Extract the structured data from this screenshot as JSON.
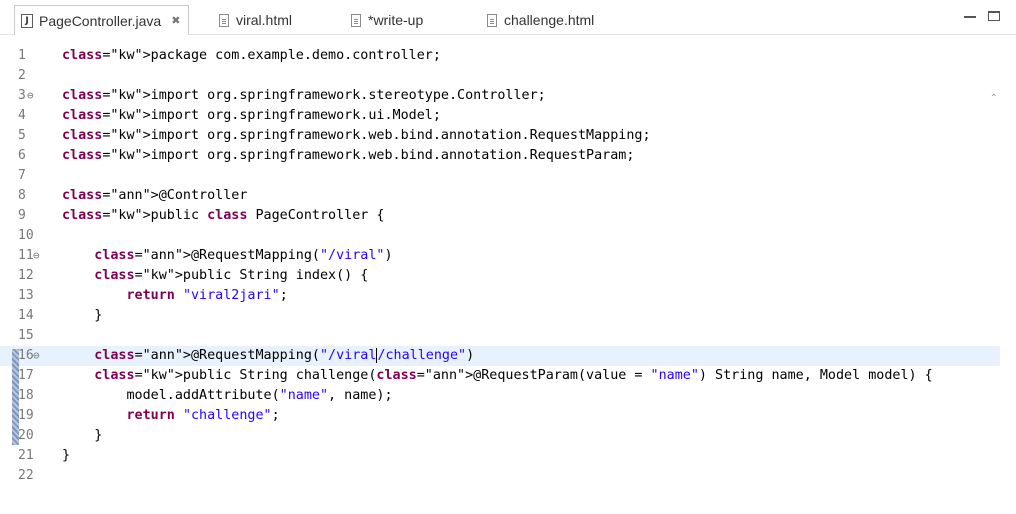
{
  "tabs": [
    {
      "label": "PageController.java",
      "icon": "java-file-icon",
      "active": true,
      "close": "✖"
    },
    {
      "label": "viral.html",
      "icon": "html-file-icon"
    },
    {
      "label": "*write-up",
      "icon": "text-file-icon"
    },
    {
      "label": "challenge.html",
      "icon": "html-file-icon"
    }
  ],
  "editor": {
    "current_line": 16,
    "lines": [
      {
        "n": "1",
        "code": "package com.example.demo.controller;"
      },
      {
        "n": "2",
        "code": ""
      },
      {
        "n": "3",
        "code": "import org.springframework.stereotype.Controller;",
        "fold": "⊖"
      },
      {
        "n": "4",
        "code": "import org.springframework.ui.Model;"
      },
      {
        "n": "5",
        "code": "import org.springframework.web.bind.annotation.RequestMapping;"
      },
      {
        "n": "6",
        "code": "import org.springframework.web.bind.annotation.RequestParam;"
      },
      {
        "n": "7",
        "code": ""
      },
      {
        "n": "8",
        "code": "@Controller"
      },
      {
        "n": "9",
        "code": "public class PageController {"
      },
      {
        "n": "10",
        "code": ""
      },
      {
        "n": "11",
        "code": "    @RequestMapping(\"/viral\")",
        "fold": "⊖"
      },
      {
        "n": "12",
        "code": "    public String index() {"
      },
      {
        "n": "13",
        "code": "        return \"viral2jari\";"
      },
      {
        "n": "14",
        "code": "    }"
      },
      {
        "n": "15",
        "code": ""
      },
      {
        "n": "16",
        "code": "    @RequestMapping(\"/viral/challenge\")",
        "fold": "⊖"
      },
      {
        "n": "17",
        "code": "    public String challenge(@RequestParam(value = \"name\") String name, Model model) {"
      },
      {
        "n": "18",
        "code": "        model.addAttribute(\"name\", name);"
      },
      {
        "n": "19",
        "code": "        return \"challenge\";"
      },
      {
        "n": "20",
        "code": "    }"
      },
      {
        "n": "21",
        "code": "}"
      },
      {
        "n": "22",
        "code": ""
      }
    ]
  }
}
